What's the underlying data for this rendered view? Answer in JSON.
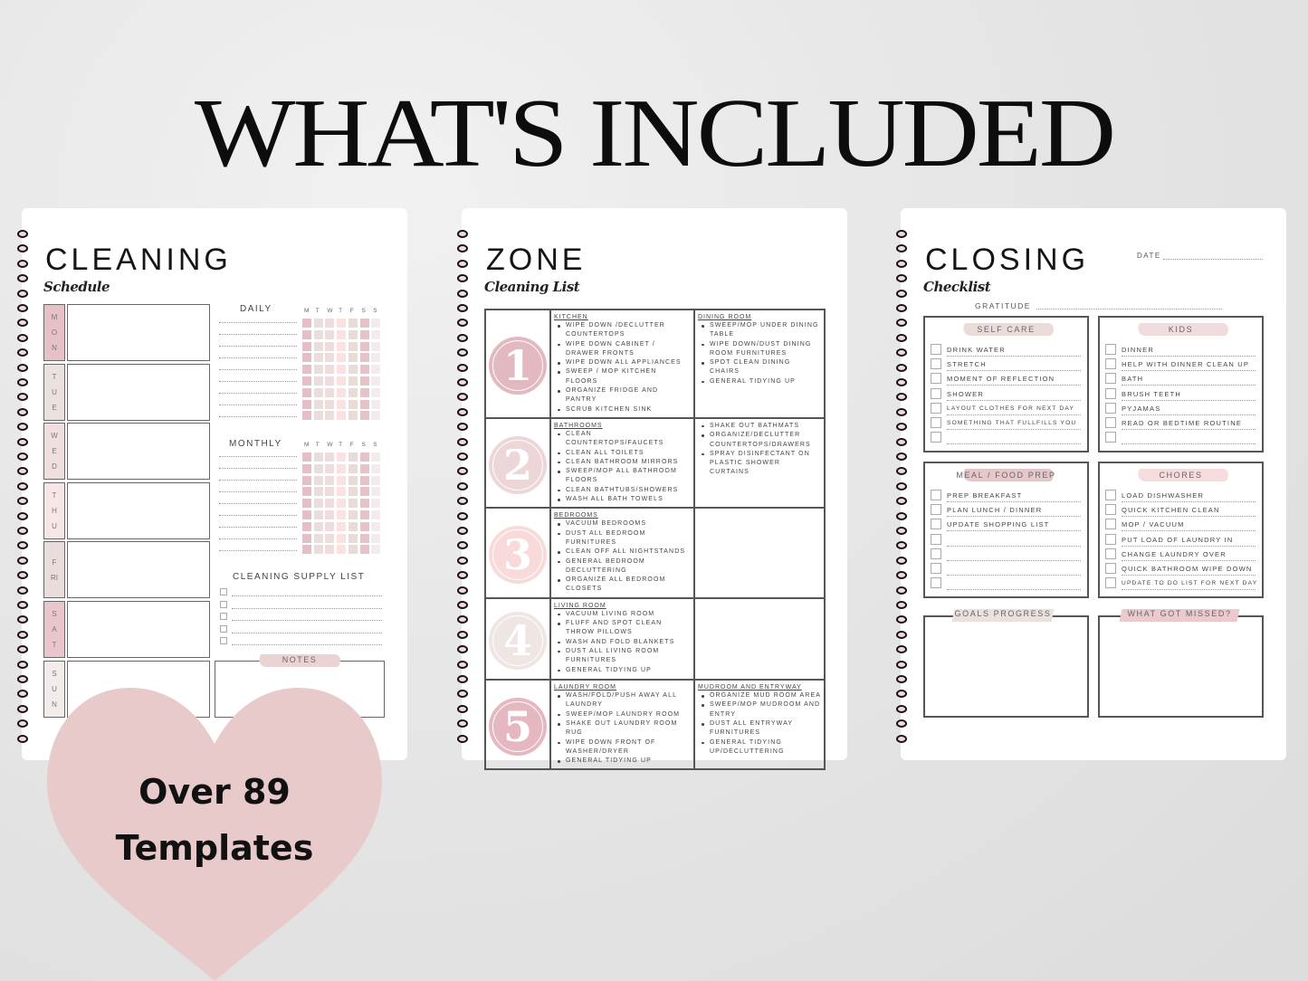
{
  "header": {
    "title": "WHAT'S INCLUDED"
  },
  "badge": {
    "line1": "Over 89",
    "line2": "Templates",
    "color": "#e8cacb"
  },
  "cleaning": {
    "title": "CLEANING",
    "subtitle": "Schedule",
    "days": [
      {
        "label": "MON",
        "color": "#e6c2c8"
      },
      {
        "label": "TUE",
        "color": "#ebe2df"
      },
      {
        "label": "WED",
        "color": "#f1dfe0"
      },
      {
        "label": "THU",
        "color": "#f6e6e6"
      },
      {
        "label": "FRI",
        "color": "#e9dddb"
      },
      {
        "label": "SAT",
        "color": "#e8c6cb"
      },
      {
        "label": "SUN",
        "color": "#f4ecea"
      }
    ],
    "daily_label": "DAILY",
    "monthly_label": "MONTHLY",
    "tracker_days": [
      "M",
      "T",
      "W",
      "T",
      "F",
      "S",
      "S"
    ],
    "tracker_colors": [
      "#e6bfc6",
      "#e9dedb",
      "#efdcdc",
      "#fbe1e1",
      "#e8dcd9",
      "#e6c3c8",
      "#f4ecec"
    ],
    "supply_label": "CLEANING SUPPLY LIST",
    "notes_label": "NOTES"
  },
  "zone": {
    "title": "ZONE",
    "subtitle": "Cleaning List",
    "rows": [
      {
        "number": "1",
        "color": "#e3b9c1",
        "left": {
          "heading": "KITCHEN",
          "items": [
            "Wipe down /declutter countertops",
            "Wipe down cabinet / drawer fronts",
            "Wipe down all appliances",
            "Sweep / mop kitchen floors",
            "Organize fridge and pantry",
            "Scrub kitchen sink"
          ]
        },
        "right": {
          "heading": "DINING ROOM",
          "items": [
            "Sweep/mop under dining table",
            "Wipe down/dust dining room furnitures",
            "Spot clean dining chairs",
            "General tidying up"
          ]
        }
      },
      {
        "number": "2",
        "color": "#ecd6d7",
        "left": {
          "heading": "BATHROOMS",
          "items": [
            "Clean countertops/faucets",
            "Clean all toilets",
            "Clean bathroom mirrors",
            "Sweep/mop all bathroom floors",
            "Clean bathtubs/showers",
            "Wash all bath towels"
          ]
        },
        "right": {
          "heading": "",
          "items": [
            "Shake out bathmats",
            "Organize/declutter countertops/drawers",
            "Spray disinfectant on plastic shower curtains"
          ]
        }
      },
      {
        "number": "3",
        "color": "#f8dadb",
        "left": {
          "heading": "BEDROOMS",
          "items": [
            "Vacuum bedrooms",
            "Dust all bedroom furnitures",
            "Clean off all nightstands",
            "General bedroom decluttering",
            "Organize all bedroom closets"
          ]
        },
        "right": {
          "heading": "",
          "items": []
        }
      },
      {
        "number": "4",
        "color": "#efe5e3",
        "left": {
          "heading": "LIVING ROOM",
          "items": [
            "Vacuum living room",
            "Fluff and spot clean throw pillows",
            "Wash and fold blankets",
            "Dust all living room furnitures",
            "General tidying up"
          ]
        },
        "right": {
          "heading": "",
          "items": []
        }
      },
      {
        "number": "5",
        "color": "#e5b8c1",
        "left": {
          "heading": "LAUNDRY ROOM",
          "items": [
            "Wash/fold/push away all laundry",
            "Sweep/mop laundry room",
            "Shake out laundry room rug",
            "Wipe down front of washer/dryer",
            "General tidying up"
          ]
        },
        "right": {
          "heading": "MUDROOM AND ENTRYWAY",
          "items": [
            "Organize mud room area",
            "Sweep/mop mudroom and entry",
            "Dust all entryway furnitures",
            "General tidying up/decluttering"
          ]
        }
      }
    ]
  },
  "closing": {
    "title": "CLOSING",
    "subtitle": "Checklist",
    "date_label": "DATE",
    "gratitude_label": "GRATITUDE",
    "sections": [
      {
        "title": "SELF CARE",
        "brush": "#ecdcd9",
        "items": [
          "Drink water",
          "Stretch",
          "Moment of reflection",
          "Shower",
          "Layout clothes for next day",
          "Something that fullfills you",
          ""
        ]
      },
      {
        "title": "KIDS",
        "brush": "#f0dcdc",
        "items": [
          "Dinner",
          "Help with dinner clean up",
          "Bath",
          "Brush teeth",
          "Pyjamas",
          "Read or bedtime routine",
          ""
        ]
      },
      {
        "title": "MEAL / FOOD PREP",
        "brush": "#e6c7c9",
        "items": [
          "Prep breakfast",
          "Plan lunch / dinner",
          "Update shopping list",
          "",
          "",
          "",
          ""
        ]
      },
      {
        "title": "CHORES",
        "brush": "#f6dcdc",
        "items": [
          "Load dishwasher",
          "Quick kitchen clean",
          "Mop / vacuum",
          "Put load of laundry in",
          "Change laundry over",
          "Quick bathroom wipe down",
          "Update to do list for next day"
        ]
      }
    ],
    "goals_label": "GOALS PROGRESS",
    "missed_label": "WHAT GOT MISSED?"
  }
}
